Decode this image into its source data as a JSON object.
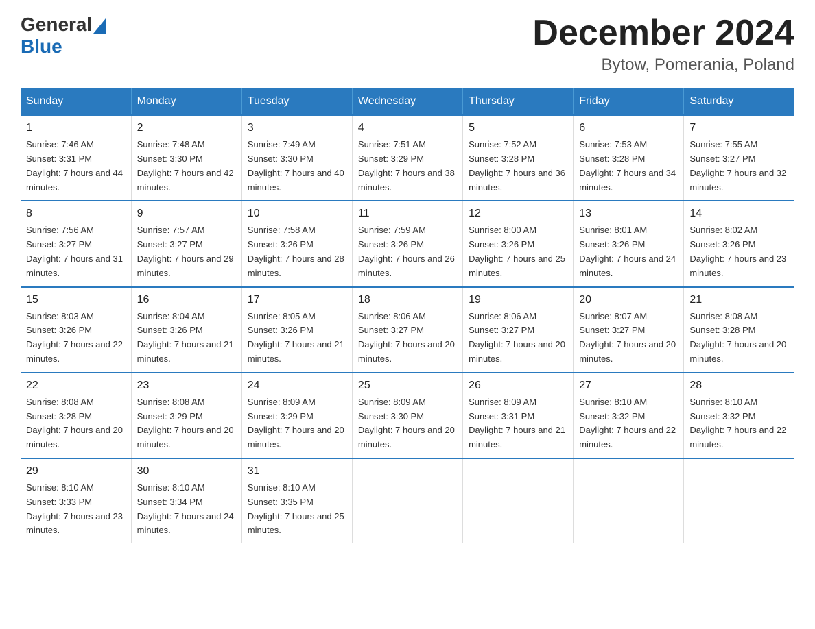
{
  "logo": {
    "text_general": "General",
    "text_blue": "Blue"
  },
  "title": "December 2024",
  "subtitle": "Bytow, Pomerania, Poland",
  "days_of_week": [
    "Sunday",
    "Monday",
    "Tuesday",
    "Wednesday",
    "Thursday",
    "Friday",
    "Saturday"
  ],
  "weeks": [
    [
      {
        "day": "1",
        "sunrise": "7:46 AM",
        "sunset": "3:31 PM",
        "daylight": "7 hours and 44 minutes."
      },
      {
        "day": "2",
        "sunrise": "7:48 AM",
        "sunset": "3:30 PM",
        "daylight": "7 hours and 42 minutes."
      },
      {
        "day": "3",
        "sunrise": "7:49 AM",
        "sunset": "3:30 PM",
        "daylight": "7 hours and 40 minutes."
      },
      {
        "day": "4",
        "sunrise": "7:51 AM",
        "sunset": "3:29 PM",
        "daylight": "7 hours and 38 minutes."
      },
      {
        "day": "5",
        "sunrise": "7:52 AM",
        "sunset": "3:28 PM",
        "daylight": "7 hours and 36 minutes."
      },
      {
        "day": "6",
        "sunrise": "7:53 AM",
        "sunset": "3:28 PM",
        "daylight": "7 hours and 34 minutes."
      },
      {
        "day": "7",
        "sunrise": "7:55 AM",
        "sunset": "3:27 PM",
        "daylight": "7 hours and 32 minutes."
      }
    ],
    [
      {
        "day": "8",
        "sunrise": "7:56 AM",
        "sunset": "3:27 PM",
        "daylight": "7 hours and 31 minutes."
      },
      {
        "day": "9",
        "sunrise": "7:57 AM",
        "sunset": "3:27 PM",
        "daylight": "7 hours and 29 minutes."
      },
      {
        "day": "10",
        "sunrise": "7:58 AM",
        "sunset": "3:26 PM",
        "daylight": "7 hours and 28 minutes."
      },
      {
        "day": "11",
        "sunrise": "7:59 AM",
        "sunset": "3:26 PM",
        "daylight": "7 hours and 26 minutes."
      },
      {
        "day": "12",
        "sunrise": "8:00 AM",
        "sunset": "3:26 PM",
        "daylight": "7 hours and 25 minutes."
      },
      {
        "day": "13",
        "sunrise": "8:01 AM",
        "sunset": "3:26 PM",
        "daylight": "7 hours and 24 minutes."
      },
      {
        "day": "14",
        "sunrise": "8:02 AM",
        "sunset": "3:26 PM",
        "daylight": "7 hours and 23 minutes."
      }
    ],
    [
      {
        "day": "15",
        "sunrise": "8:03 AM",
        "sunset": "3:26 PM",
        "daylight": "7 hours and 22 minutes."
      },
      {
        "day": "16",
        "sunrise": "8:04 AM",
        "sunset": "3:26 PM",
        "daylight": "7 hours and 21 minutes."
      },
      {
        "day": "17",
        "sunrise": "8:05 AM",
        "sunset": "3:26 PM",
        "daylight": "7 hours and 21 minutes."
      },
      {
        "day": "18",
        "sunrise": "8:06 AM",
        "sunset": "3:27 PM",
        "daylight": "7 hours and 20 minutes."
      },
      {
        "day": "19",
        "sunrise": "8:06 AM",
        "sunset": "3:27 PM",
        "daylight": "7 hours and 20 minutes."
      },
      {
        "day": "20",
        "sunrise": "8:07 AM",
        "sunset": "3:27 PM",
        "daylight": "7 hours and 20 minutes."
      },
      {
        "day": "21",
        "sunrise": "8:08 AM",
        "sunset": "3:28 PM",
        "daylight": "7 hours and 20 minutes."
      }
    ],
    [
      {
        "day": "22",
        "sunrise": "8:08 AM",
        "sunset": "3:28 PM",
        "daylight": "7 hours and 20 minutes."
      },
      {
        "day": "23",
        "sunrise": "8:08 AM",
        "sunset": "3:29 PM",
        "daylight": "7 hours and 20 minutes."
      },
      {
        "day": "24",
        "sunrise": "8:09 AM",
        "sunset": "3:29 PM",
        "daylight": "7 hours and 20 minutes."
      },
      {
        "day": "25",
        "sunrise": "8:09 AM",
        "sunset": "3:30 PM",
        "daylight": "7 hours and 20 minutes."
      },
      {
        "day": "26",
        "sunrise": "8:09 AM",
        "sunset": "3:31 PM",
        "daylight": "7 hours and 21 minutes."
      },
      {
        "day": "27",
        "sunrise": "8:10 AM",
        "sunset": "3:32 PM",
        "daylight": "7 hours and 22 minutes."
      },
      {
        "day": "28",
        "sunrise": "8:10 AM",
        "sunset": "3:32 PM",
        "daylight": "7 hours and 22 minutes."
      }
    ],
    [
      {
        "day": "29",
        "sunrise": "8:10 AM",
        "sunset": "3:33 PM",
        "daylight": "7 hours and 23 minutes."
      },
      {
        "day": "30",
        "sunrise": "8:10 AM",
        "sunset": "3:34 PM",
        "daylight": "7 hours and 24 minutes."
      },
      {
        "day": "31",
        "sunrise": "8:10 AM",
        "sunset": "3:35 PM",
        "daylight": "7 hours and 25 minutes."
      },
      null,
      null,
      null,
      null
    ]
  ]
}
